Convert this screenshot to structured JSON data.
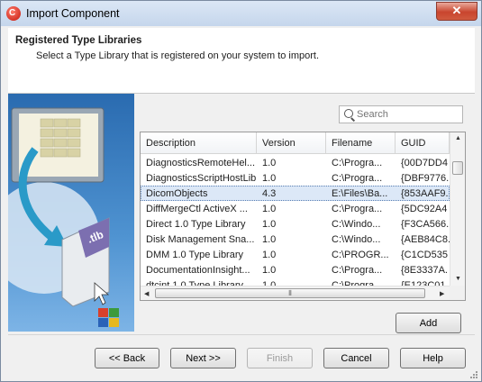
{
  "window": {
    "title": "Import Component",
    "close_glyph": "✕"
  },
  "header": {
    "title": "Registered Type Libraries",
    "subtitle": "Select a Type Library that is registered on your system to import."
  },
  "illustration": {
    "file_label": ".tlb"
  },
  "search": {
    "placeholder": "Search",
    "value": ""
  },
  "table": {
    "columns": [
      "Description",
      "Version",
      "Filename",
      "GUID"
    ],
    "rows": [
      [
        "DiagnosticsRemoteHel...",
        "1.0",
        "C:\\Progra...",
        "{00D7DD4"
      ],
      [
        "DiagnosticsScriptHostLib",
        "1.0",
        "C:\\Progra...",
        "{DBF9776."
      ],
      [
        "DicomObjects",
        "4.3",
        "E:\\Files\\Ba...",
        "{853AAF9."
      ],
      [
        "DiffMergeCtl ActiveX ...",
        "1.0",
        "C:\\Progra...",
        "{5DC92A4"
      ],
      [
        "Direct 1.0 Type Library",
        "1.0",
        "C:\\Windo...",
        "{F3CA566."
      ],
      [
        "Disk Management Sna...",
        "1.0",
        "C:\\Windo...",
        "{AEB84C8."
      ],
      [
        "DMM 1.0 Type Library",
        "1.0",
        "C:\\PROGR...",
        "{C1CD535"
      ],
      [
        "DocumentationInsight...",
        "1.0",
        "C:\\Progra...",
        "{8E3337A."
      ],
      [
        "dtcint 1.0 Type Library",
        "1.0",
        "C:\\Progra...",
        "{E123C01."
      ]
    ],
    "selected_row_index": 2
  },
  "buttons": {
    "add": "Add",
    "back": "<< Back",
    "next": "Next >>",
    "finish": "Finish",
    "cancel": "Cancel",
    "help": "Help"
  }
}
